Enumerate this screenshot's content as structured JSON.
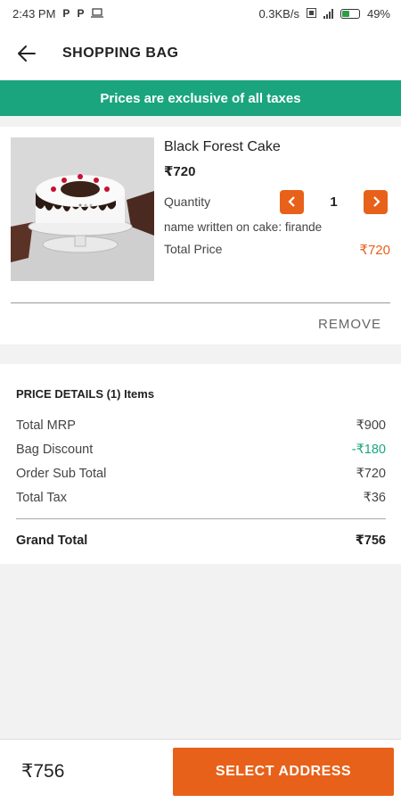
{
  "status_bar": {
    "time": "2:43 PM",
    "left_icons": [
      "P",
      "P"
    ],
    "network_speed": "0.3KB/s",
    "battery": "49%"
  },
  "app_bar": {
    "title": "SHOPPING BAG",
    "back_icon": "arrow-left"
  },
  "banner": {
    "text": "Prices are exclusive of all taxes",
    "color": "#1aa57e"
  },
  "item": {
    "name": "Black Forest Cake",
    "price": "₹720",
    "quantity_label": "Quantity",
    "quantity": "1",
    "cake_text": "name written on cake: firande",
    "total_label": "Total Price",
    "total_value": "₹720",
    "remove_label": "REMOVE"
  },
  "price_details": {
    "header": "PRICE DETAILS  (1) Items",
    "rows": [
      {
        "label": "Total MRP",
        "value": "₹900"
      },
      {
        "label": "Bag Discount",
        "value": "-₹180"
      },
      {
        "label": "Order Sub Total",
        "value": "₹720"
      },
      {
        "label": "Total Tax",
        "value": "₹36"
      }
    ],
    "grand_label": "Grand Total",
    "grand_value": "₹756"
  },
  "bottom_bar": {
    "total": "₹756",
    "button_label": "SELECT ADDRESS",
    "accent": "#e8611a"
  }
}
